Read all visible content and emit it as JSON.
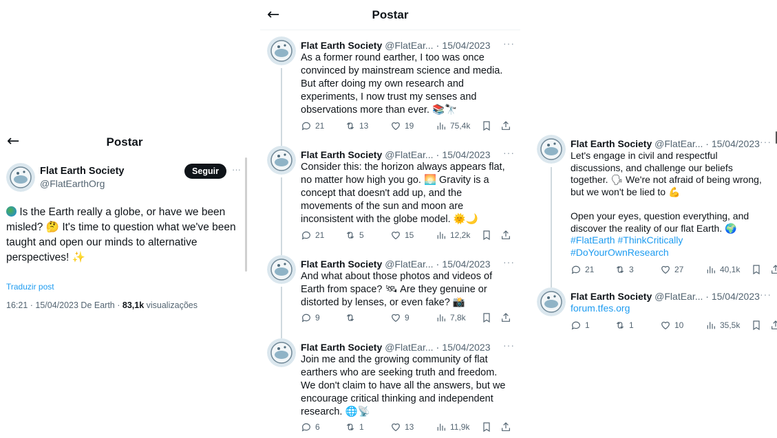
{
  "left": {
    "header": {
      "title": "Postar"
    },
    "user": {
      "name": "Flat Earth Society",
      "handle": "@FlatEarthOrg"
    },
    "follow_label": "Seguir",
    "post_text": "Is the Earth really a globe, or have we been misled? 🤔 It's time to question what we've been taught and open our minds to alternative perspectives! ✨",
    "translate_label": "Traduzir post",
    "meta_time": "16:21 · 15/04/2023 De Earth · ",
    "meta_views": "83,1k",
    "meta_views_label": " visualizações"
  },
  "middle": {
    "header": {
      "title": "Postar"
    },
    "tweets": [
      {
        "name": "Flat Earth Society",
        "handle": "@FlatEar...",
        "date": "15/04/2023",
        "text": "As a former round earther, I too was once convinced by mainstream science and media. But after doing my own research and experiments, I now trust my senses and observations more than ever. 📚🔭",
        "replies": "21",
        "retweets": "13",
        "likes": "19",
        "views": "75,4k"
      },
      {
        "name": "Flat Earth Society",
        "handle": "@FlatEar...",
        "date": "15/04/2023",
        "text": "Consider this: the horizon always appears flat, no matter how high you go. 🌅 Gravity is a concept that doesn't add up, and the movements of the sun and moon are inconsistent with the globe model. 🌞🌙",
        "replies": "21",
        "retweets": "5",
        "likes": "15",
        "views": "12,2k"
      },
      {
        "name": "Flat Earth Society",
        "handle": "@FlatEar...",
        "date": "15/04/2023",
        "text": "And what about those photos and videos of Earth from space? 🛰 Are they genuine or distorted by lenses, or even fake? 📸",
        "replies": "9",
        "retweets": "",
        "likes": "9",
        "views": "7,8k"
      },
      {
        "name": "Flat Earth Society",
        "handle": "@FlatEar...",
        "date": "15/04/2023",
        "text": "Join me and the growing community of flat earthers who are seeking truth and freedom. We don't claim to have all the answers, but we encourage critical thinking and independent research. 🌐📡",
        "replies": "6",
        "retweets": "1",
        "likes": "13",
        "views": "11,9k"
      }
    ]
  },
  "right": {
    "tweets": [
      {
        "name": "Flat Earth Society",
        "handle": "@FlatEar...",
        "date": "15/04/2023",
        "text": "Let's engage in civil and respectful discussions, and challenge our beliefs together. 🗣 We're not afraid of being wrong, but we won't be lied to 💪\n\nOpen your eyes, question everything, and discover the reality of our flat Earth. 🌍",
        "hashtags": "#FlatEarth #ThinkCritically\n#DoYourOwnResearch",
        "replies": "21",
        "retweets": "3",
        "likes": "27",
        "views": "40,1k"
      },
      {
        "name": "Flat Earth Society",
        "handle": "@FlatEar...",
        "date": "15/04/2023",
        "link": "forum.tfes.org",
        "replies": "1",
        "retweets": "1",
        "likes": "10",
        "views": "35,5k"
      }
    ]
  },
  "icons": [
    "back-arrow-icon",
    "reply-icon",
    "retweet-icon",
    "like-icon",
    "views-icon",
    "bookmark-icon",
    "share-icon",
    "more-icon"
  ],
  "colors": {
    "link": "#1d9bf0",
    "muted": "#536471",
    "follow_bg": "#0f1419",
    "divider": "#cfd9de"
  }
}
